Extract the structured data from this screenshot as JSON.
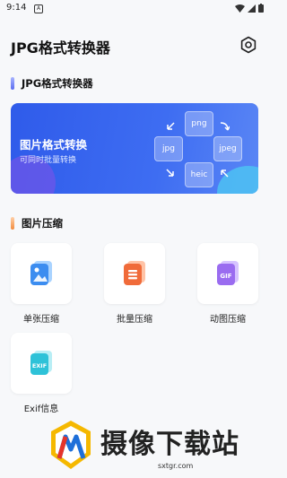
{
  "status": {
    "time": "9:14",
    "a_icon": "A"
  },
  "app": {
    "title": "JPG格式转换器"
  },
  "section1": {
    "title": "JPG格式转换器",
    "bar_color": "#6c7cf0"
  },
  "banner": {
    "title": "图片格式转换",
    "subtitle": "可同时批量转换",
    "formats": {
      "top": "png",
      "left": "jpg",
      "right": "jpeg",
      "bottom": "heic"
    }
  },
  "section2": {
    "title": "图片压缩",
    "bar_color": "#f59a4d"
  },
  "tools": [
    {
      "label": "单张压缩",
      "icon": "single-image-icon",
      "color": "#3c8df0"
    },
    {
      "label": "批量压缩",
      "icon": "batch-image-icon",
      "color": "#f06b3a"
    },
    {
      "label": "动图压缩",
      "icon": "gif-icon",
      "color": "#9a6cf0",
      "badge": "GIF"
    },
    {
      "label": "Exif信息",
      "icon": "exif-icon",
      "color": "#2ec2d8",
      "badge": "EXIF"
    }
  ],
  "watermark": {
    "text": "摄像下载站",
    "url": "sxtgr.com"
  }
}
